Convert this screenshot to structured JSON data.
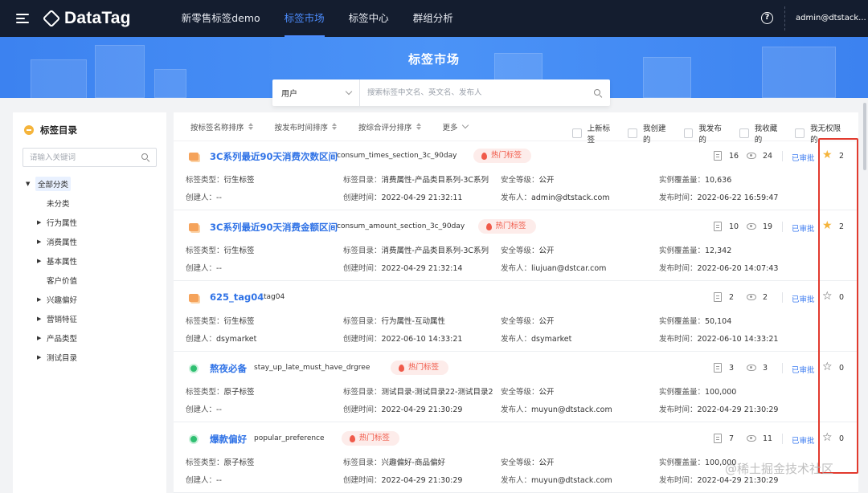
{
  "topnav": {
    "brand": "DataTag",
    "items": [
      {
        "label": "新零售标签demo"
      },
      {
        "label": "标签市场"
      },
      {
        "label": "标签中心"
      },
      {
        "label": "群组分析"
      }
    ],
    "active_item": "标签市场",
    "help_glyph": "?",
    "user": "admin@dtstack..."
  },
  "banner": {
    "title": "标签市场"
  },
  "search": {
    "entity_selected": "用户",
    "placeholder": "搜索标签中文名、英文名、发布人"
  },
  "sidebar": {
    "title": "标签目录",
    "search_placeholder": "请输入关键词",
    "root": "全部分类",
    "children": [
      {
        "label": "未分类",
        "expandable": false
      },
      {
        "label": "行为属性",
        "expandable": true
      },
      {
        "label": "消费属性",
        "expandable": true
      },
      {
        "label": "基本属性",
        "expandable": true
      },
      {
        "label": "客户价值",
        "expandable": false
      },
      {
        "label": "兴趣偏好",
        "expandable": true
      },
      {
        "label": "营销特征",
        "expandable": true
      },
      {
        "label": "产品类型",
        "expandable": true
      },
      {
        "label": "测试目录",
        "expandable": true
      }
    ]
  },
  "sortbar": {
    "sorts": [
      "按标签名称排序",
      "按发布时间排序",
      "按综合评分排序"
    ],
    "more": "更多",
    "filters": [
      "上新标签",
      "我创建的",
      "我发布的",
      "我收藏的",
      "我无权限的"
    ]
  },
  "field_labels": {
    "type": "标签类型：",
    "catalog": "标签目录：",
    "security": "安全等级：",
    "coverage": "实例覆盖量：",
    "creator": "创建人：",
    "created": "创建时间：",
    "publisher": "发布人：",
    "published": "发布时间："
  },
  "tags": [
    {
      "name": "3C系列最近90天消费次数区间",
      "code": "consum_times_section_3c_90day",
      "hot": "热门标签",
      "icon": "orange-tag-icon",
      "usage": "16",
      "views": "24",
      "status": "已审批",
      "favorited": true,
      "favorites": "2",
      "type": "衍生标签",
      "catalog": "消费属性-产品类目系列-3C系列",
      "security": "公开",
      "coverage": "10,636",
      "creator": "--",
      "created": "2022-04-29 21:32:11",
      "publisher": "admin@dtstack.com",
      "published": "2022-06-22 16:59:47"
    },
    {
      "name": "3C系列最近90天消费金额区间",
      "code": "consum_amount_section_3c_90day",
      "hot": "热门标签",
      "icon": "orange-tag-icon",
      "usage": "10",
      "views": "19",
      "status": "已审批",
      "favorited": true,
      "favorites": "2",
      "type": "衍生标签",
      "catalog": "消费属性-产品类目系列-3C系列",
      "security": "公开",
      "coverage": "12,342",
      "creator": "--",
      "created": "2022-04-29 21:32:14",
      "publisher": "liujuan@dstcar.com",
      "published": "2022-06-20 14:07:43"
    },
    {
      "name": "625_tag04",
      "code": "tag04",
      "hot": "",
      "icon": "orange-tag-icon",
      "usage": "2",
      "views": "2",
      "status": "已审批",
      "favorited": false,
      "favorites": "0",
      "type": "衍生标签",
      "catalog": "行为属性-互动属性",
      "security": "公开",
      "coverage": "50,104",
      "creator": "dsymarket",
      "created": "2022-06-10 14:33:21",
      "publisher": "dsymarket",
      "published": "2022-06-10 14:33:21"
    },
    {
      "name": "熬夜必备",
      "code": "stay_up_late_must_have_drgree",
      "hot": "热门标签",
      "icon": "green-tag-icon",
      "usage": "3",
      "views": "3",
      "status": "已审批",
      "favorited": false,
      "favorites": "0",
      "type": "原子标签",
      "catalog": "测试目录-测试目录22-测试目录2",
      "security": "公开",
      "coverage": "100,000",
      "creator": "--",
      "created": "2022-04-29 21:30:29",
      "publisher": "muyun@dtstack.com",
      "published": "2022-04-29 21:30:29"
    },
    {
      "name": "爆款偏好",
      "code": "popular_preference",
      "hot": "热门标签",
      "icon": "green-tag-icon",
      "usage": "7",
      "views": "11",
      "status": "已审批",
      "favorited": false,
      "favorites": "0",
      "type": "原子标签",
      "catalog": "兴趣偏好-商品偏好",
      "security": "公开",
      "coverage": "100,000",
      "creator": "--",
      "created": "2022-04-29 21:30:29",
      "publisher": "muyun@dtstack.com",
      "published": "2022-04-29 21:30:29"
    }
  ],
  "watermark": "@稀土掘金技术社区",
  "colors": {
    "nav_bg": "#141d2f",
    "accent": "#3a7af0",
    "banner": "#4b93f7",
    "hot": "#f05a4a",
    "star": "#f5b43b",
    "highlight": "#e23a2e"
  }
}
